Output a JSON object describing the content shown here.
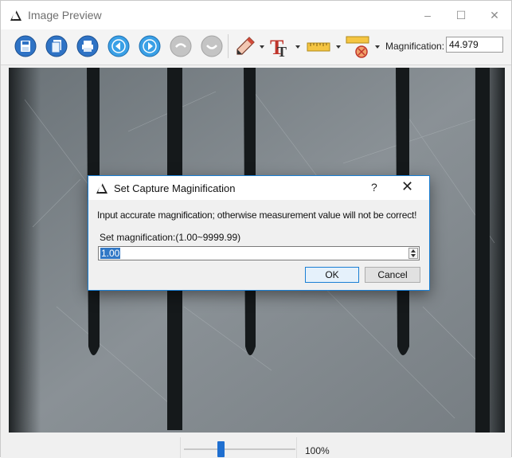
{
  "window": {
    "title": "Image Preview",
    "minimize": "–",
    "maximize": "☐",
    "close": "✕"
  },
  "toolbar": {
    "buttons": [
      {
        "name": "save-icon",
        "color": "#2f73c5"
      },
      {
        "name": "copy-icon",
        "color": "#2f73c5"
      },
      {
        "name": "print-icon",
        "color": "#2f73c5"
      },
      {
        "name": "previous-icon",
        "color": "#3aa0e6"
      },
      {
        "name": "next-icon",
        "color": "#3aa0e6"
      },
      {
        "name": "undo-icon",
        "color": "#b7b7b7"
      },
      {
        "name": "redo-icon",
        "color": "#b7b7b7"
      }
    ],
    "magnification_label": "Magnification:",
    "magnification_value": "44.979"
  },
  "dialog": {
    "title": "Set Capture Maginification",
    "help": "?",
    "close": "✕",
    "message": "Input accurate magnification; otherwise measurement value will not be correct!",
    "set_label": "Set magnification:(1.00~9999.99)",
    "value": "1.00",
    "ok_label": "OK",
    "cancel_label": "Cancel"
  },
  "status": {
    "zoom": "100%",
    "zoom_level": 0.33
  },
  "colors": {
    "accent": "#1a7fd4",
    "preview_bg": "#363a3c",
    "slider_thumb": "#1f6fd0"
  }
}
